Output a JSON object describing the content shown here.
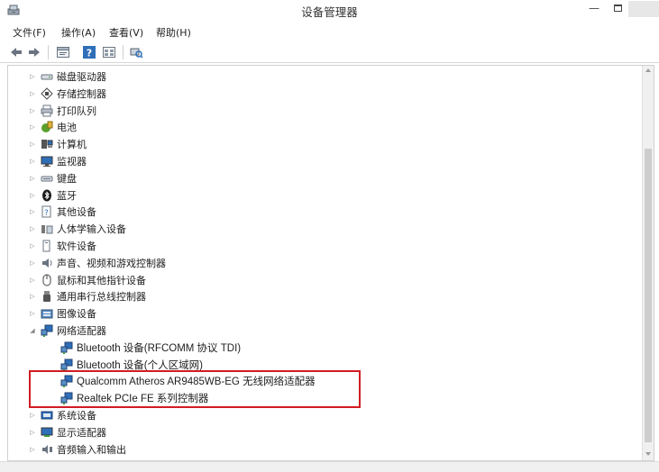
{
  "window": {
    "title": "设备管理器"
  },
  "menubar": {
    "items": [
      "文件(F)",
      "操作(A)",
      "查看(V)",
      "帮助(H)"
    ]
  },
  "toolbar": {
    "buttons": [
      "back-arrow-icon",
      "forward-arrow-icon",
      "properties-icon",
      "help-icon",
      "view-icon",
      "scan-hardware-icon"
    ]
  },
  "tree": {
    "categories": [
      {
        "label": "磁盘驱动器",
        "expanded": false,
        "icon": "disk-drive-icon"
      },
      {
        "label": "存储控制器",
        "expanded": false,
        "icon": "storage-controller-icon"
      },
      {
        "label": "打印队列",
        "expanded": false,
        "icon": "printer-icon"
      },
      {
        "label": "电池",
        "expanded": false,
        "icon": "battery-icon"
      },
      {
        "label": "计算机",
        "expanded": false,
        "icon": "computer-icon"
      },
      {
        "label": "监视器",
        "expanded": false,
        "icon": "monitor-icon"
      },
      {
        "label": "键盘",
        "expanded": false,
        "icon": "keyboard-icon"
      },
      {
        "label": "蓝牙",
        "expanded": false,
        "icon": "bluetooth-icon"
      },
      {
        "label": "其他设备",
        "expanded": false,
        "icon": "other-devices-icon"
      },
      {
        "label": "人体学输入设备",
        "expanded": false,
        "icon": "hid-icon"
      },
      {
        "label": "软件设备",
        "expanded": false,
        "icon": "software-device-icon"
      },
      {
        "label": "声音、视频和游戏控制器",
        "expanded": false,
        "icon": "sound-icon"
      },
      {
        "label": "鼠标和其他指针设备",
        "expanded": false,
        "icon": "mouse-icon"
      },
      {
        "label": "通用串行总线控制器",
        "expanded": false,
        "icon": "usb-icon"
      },
      {
        "label": "图像设备",
        "expanded": false,
        "icon": "camera-icon"
      },
      {
        "label": "网络适配器",
        "expanded": true,
        "icon": "network-adapter-icon",
        "children": [
          {
            "label": "Bluetooth 设备(RFCOMM 协议 TDI)",
            "icon": "network-adapter-icon"
          },
          {
            "label": "Bluetooth 设备(个人区域网)",
            "icon": "network-adapter-icon"
          },
          {
            "label": "Qualcomm Atheros AR9485WB-EG 无线网络适配器",
            "icon": "network-adapter-icon",
            "highlighted": true
          },
          {
            "label": "Realtek PCIe FE 系列控制器",
            "icon": "network-adapter-icon",
            "highlighted": true
          }
        ]
      },
      {
        "label": "系统设备",
        "expanded": false,
        "icon": "system-device-icon"
      },
      {
        "label": "显示适配器",
        "expanded": false,
        "icon": "display-adapter-icon"
      },
      {
        "label": "音频输入和输出",
        "expanded": false,
        "icon": "audio-io-icon"
      }
    ]
  },
  "colors": {
    "highlight_border": "#d21c23"
  }
}
